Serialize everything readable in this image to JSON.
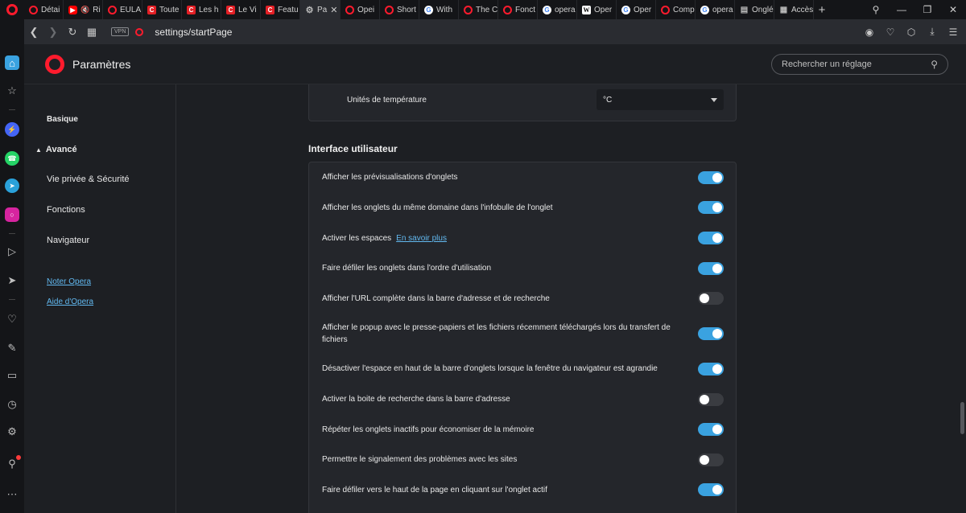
{
  "tabs": [
    {
      "label": "Détai",
      "favicon": "opera",
      "active": false
    },
    {
      "label": "Ri",
      "favicon": "youtube",
      "active": false
    },
    {
      "label": "EULA",
      "favicon": "opera",
      "active": false
    },
    {
      "label": "Toute",
      "favicon": "red-c",
      "active": false
    },
    {
      "label": "Les h",
      "favicon": "red-c",
      "active": false
    },
    {
      "label": "Le Vi",
      "favicon": "red-c",
      "active": false
    },
    {
      "label": "Featu",
      "favicon": "red-c",
      "active": false
    },
    {
      "label": "Pa",
      "favicon": "gear",
      "active": true
    },
    {
      "label": "Opei",
      "favicon": "opera",
      "active": false
    },
    {
      "label": "Short",
      "favicon": "opera",
      "active": false
    },
    {
      "label": "With",
      "favicon": "google",
      "active": false
    },
    {
      "label": "The C",
      "favicon": "opera",
      "active": false
    },
    {
      "label": "Fonct",
      "favicon": "opera",
      "active": false
    },
    {
      "label": "opera",
      "favicon": "google",
      "active": false
    },
    {
      "label": "Oper",
      "favicon": "wiki",
      "active": false
    },
    {
      "label": "Oper",
      "favicon": "google",
      "active": false
    },
    {
      "label": "Comp",
      "favicon": "opera",
      "active": false
    },
    {
      "label": "opera",
      "favicon": "google",
      "active": false
    },
    {
      "label": "Onglé",
      "favicon": "bubble",
      "active": false
    },
    {
      "label": "Accès",
      "favicon": "grid",
      "active": false
    }
  ],
  "address_bar": {
    "vpn_label": "VPN",
    "url": "settings/startPage"
  },
  "header": {
    "title": "Paramètres",
    "search_placeholder": "Rechercher un réglage"
  },
  "nav": {
    "basic": "Basique",
    "advanced": "Avancé",
    "privacy": "Vie privée & Sécurité",
    "features": "Fonctions",
    "browser": "Navigateur",
    "rate_opera": "Noter Opera",
    "help": "Aide d'Opera"
  },
  "temperature": {
    "label": "Unités de température",
    "value": "°C"
  },
  "ui_section": {
    "title": "Interface utilisateur",
    "learn_more": "En savoir plus",
    "rows": [
      {
        "label": "Afficher les prévisualisations d'onglets",
        "on": true
      },
      {
        "label": "Afficher les onglets du même domaine dans l'infobulle de l'onglet",
        "on": true
      },
      {
        "label": "Activer les espaces",
        "on": true
      },
      {
        "label": "Faire défiler les onglets dans l'ordre d'utilisation",
        "on": true
      },
      {
        "label": "Afficher l'URL complète dans la barre d'adresse et de recherche",
        "on": false
      },
      {
        "label": "Afficher le popup avec le presse-papiers et les fichiers récemment téléchargés lors du transfert de fichiers",
        "on": true
      },
      {
        "label": "Désactiver l'espace en haut de la barre d'onglets lorsque la fenêtre du navigateur est agrandie",
        "on": true
      },
      {
        "label": "Activer la boite de recherche dans la barre d'adresse",
        "on": false
      },
      {
        "label": "Répéter les onglets inactifs pour économiser de la mémoire",
        "on": true
      },
      {
        "label": "Permettre le signalement des problèmes avec les sites",
        "on": false
      },
      {
        "label": "Faire défiler vers le haut de la page en cliquant sur l'onglet actif",
        "on": true
      }
    ]
  },
  "colors": {
    "accent": "#3aa2e0",
    "opera_red": "#ff1b2d",
    "link": "#62b9f0",
    "background": "#1d1f23"
  }
}
